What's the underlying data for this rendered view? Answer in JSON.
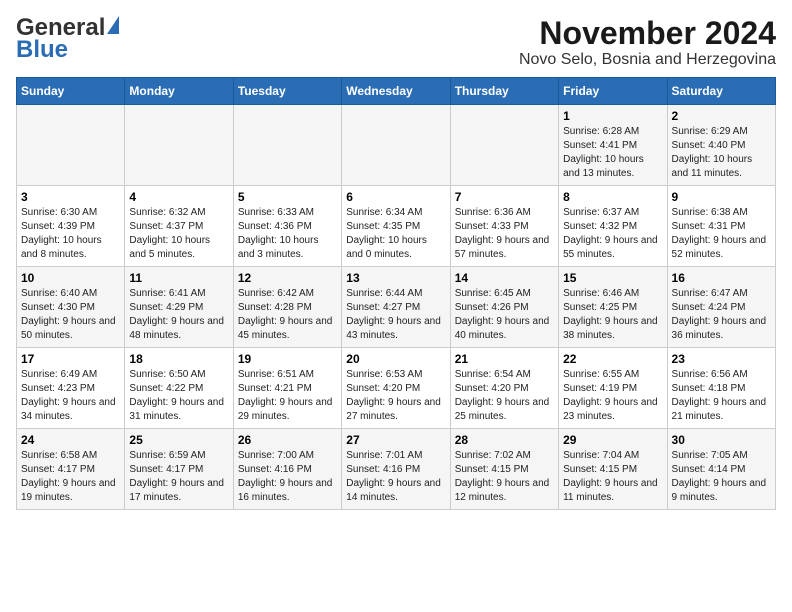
{
  "logo": {
    "line1": "General",
    "line2": "Blue"
  },
  "title": "November 2024",
  "subtitle": "Novo Selo, Bosnia and Herzegovina",
  "days_of_week": [
    "Sunday",
    "Monday",
    "Tuesday",
    "Wednesday",
    "Thursday",
    "Friday",
    "Saturday"
  ],
  "weeks": [
    [
      {
        "day": "",
        "info": ""
      },
      {
        "day": "",
        "info": ""
      },
      {
        "day": "",
        "info": ""
      },
      {
        "day": "",
        "info": ""
      },
      {
        "day": "",
        "info": ""
      },
      {
        "day": "1",
        "info": "Sunrise: 6:28 AM\nSunset: 4:41 PM\nDaylight: 10 hours and 13 minutes."
      },
      {
        "day": "2",
        "info": "Sunrise: 6:29 AM\nSunset: 4:40 PM\nDaylight: 10 hours and 11 minutes."
      }
    ],
    [
      {
        "day": "3",
        "info": "Sunrise: 6:30 AM\nSunset: 4:39 PM\nDaylight: 10 hours and 8 minutes."
      },
      {
        "day": "4",
        "info": "Sunrise: 6:32 AM\nSunset: 4:37 PM\nDaylight: 10 hours and 5 minutes."
      },
      {
        "day": "5",
        "info": "Sunrise: 6:33 AM\nSunset: 4:36 PM\nDaylight: 10 hours and 3 minutes."
      },
      {
        "day": "6",
        "info": "Sunrise: 6:34 AM\nSunset: 4:35 PM\nDaylight: 10 hours and 0 minutes."
      },
      {
        "day": "7",
        "info": "Sunrise: 6:36 AM\nSunset: 4:33 PM\nDaylight: 9 hours and 57 minutes."
      },
      {
        "day": "8",
        "info": "Sunrise: 6:37 AM\nSunset: 4:32 PM\nDaylight: 9 hours and 55 minutes."
      },
      {
        "day": "9",
        "info": "Sunrise: 6:38 AM\nSunset: 4:31 PM\nDaylight: 9 hours and 52 minutes."
      }
    ],
    [
      {
        "day": "10",
        "info": "Sunrise: 6:40 AM\nSunset: 4:30 PM\nDaylight: 9 hours and 50 minutes."
      },
      {
        "day": "11",
        "info": "Sunrise: 6:41 AM\nSunset: 4:29 PM\nDaylight: 9 hours and 48 minutes."
      },
      {
        "day": "12",
        "info": "Sunrise: 6:42 AM\nSunset: 4:28 PM\nDaylight: 9 hours and 45 minutes."
      },
      {
        "day": "13",
        "info": "Sunrise: 6:44 AM\nSunset: 4:27 PM\nDaylight: 9 hours and 43 minutes."
      },
      {
        "day": "14",
        "info": "Sunrise: 6:45 AM\nSunset: 4:26 PM\nDaylight: 9 hours and 40 minutes."
      },
      {
        "day": "15",
        "info": "Sunrise: 6:46 AM\nSunset: 4:25 PM\nDaylight: 9 hours and 38 minutes."
      },
      {
        "day": "16",
        "info": "Sunrise: 6:47 AM\nSunset: 4:24 PM\nDaylight: 9 hours and 36 minutes."
      }
    ],
    [
      {
        "day": "17",
        "info": "Sunrise: 6:49 AM\nSunset: 4:23 PM\nDaylight: 9 hours and 34 minutes."
      },
      {
        "day": "18",
        "info": "Sunrise: 6:50 AM\nSunset: 4:22 PM\nDaylight: 9 hours and 31 minutes."
      },
      {
        "day": "19",
        "info": "Sunrise: 6:51 AM\nSunset: 4:21 PM\nDaylight: 9 hours and 29 minutes."
      },
      {
        "day": "20",
        "info": "Sunrise: 6:53 AM\nSunset: 4:20 PM\nDaylight: 9 hours and 27 minutes."
      },
      {
        "day": "21",
        "info": "Sunrise: 6:54 AM\nSunset: 4:20 PM\nDaylight: 9 hours and 25 minutes."
      },
      {
        "day": "22",
        "info": "Sunrise: 6:55 AM\nSunset: 4:19 PM\nDaylight: 9 hours and 23 minutes."
      },
      {
        "day": "23",
        "info": "Sunrise: 6:56 AM\nSunset: 4:18 PM\nDaylight: 9 hours and 21 minutes."
      }
    ],
    [
      {
        "day": "24",
        "info": "Sunrise: 6:58 AM\nSunset: 4:17 PM\nDaylight: 9 hours and 19 minutes."
      },
      {
        "day": "25",
        "info": "Sunrise: 6:59 AM\nSunset: 4:17 PM\nDaylight: 9 hours and 17 minutes."
      },
      {
        "day": "26",
        "info": "Sunrise: 7:00 AM\nSunset: 4:16 PM\nDaylight: 9 hours and 16 minutes."
      },
      {
        "day": "27",
        "info": "Sunrise: 7:01 AM\nSunset: 4:16 PM\nDaylight: 9 hours and 14 minutes."
      },
      {
        "day": "28",
        "info": "Sunrise: 7:02 AM\nSunset: 4:15 PM\nDaylight: 9 hours and 12 minutes."
      },
      {
        "day": "29",
        "info": "Sunrise: 7:04 AM\nSunset: 4:15 PM\nDaylight: 9 hours and 11 minutes."
      },
      {
        "day": "30",
        "info": "Sunrise: 7:05 AM\nSunset: 4:14 PM\nDaylight: 9 hours and 9 minutes."
      }
    ]
  ]
}
